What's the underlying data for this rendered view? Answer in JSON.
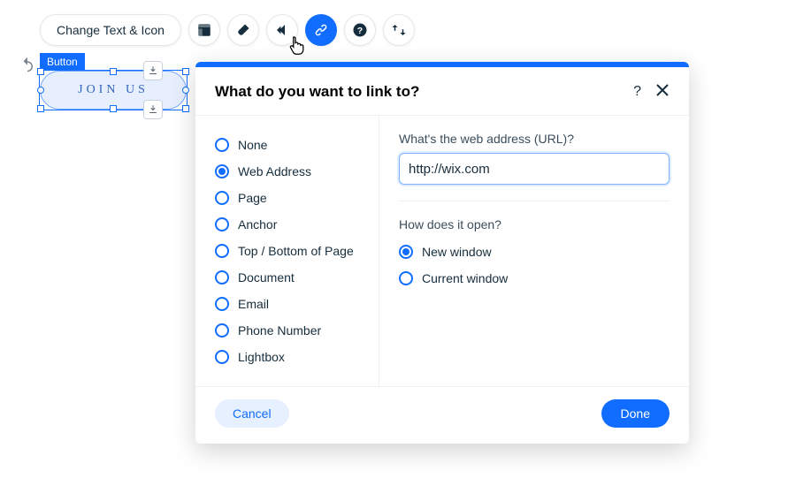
{
  "toolbar": {
    "change_text_label": "Change Text & Icon"
  },
  "selected": {
    "badge": "Button",
    "text": "JOIN US"
  },
  "dialog": {
    "title": "What do you want to link to?",
    "link_types": {
      "none": "None",
      "web_address": "Web Address",
      "page": "Page",
      "anchor": "Anchor",
      "top_bottom": "Top / Bottom of Page",
      "document": "Document",
      "email": "Email",
      "phone": "Phone Number",
      "lightbox": "Lightbox"
    },
    "url_label": "What's the web address (URL)?",
    "url_value": "http://wix.com",
    "open_label": "How does it open?",
    "open_options": {
      "new_window": "New window",
      "current_window": "Current window"
    },
    "cancel": "Cancel",
    "done": "Done"
  }
}
